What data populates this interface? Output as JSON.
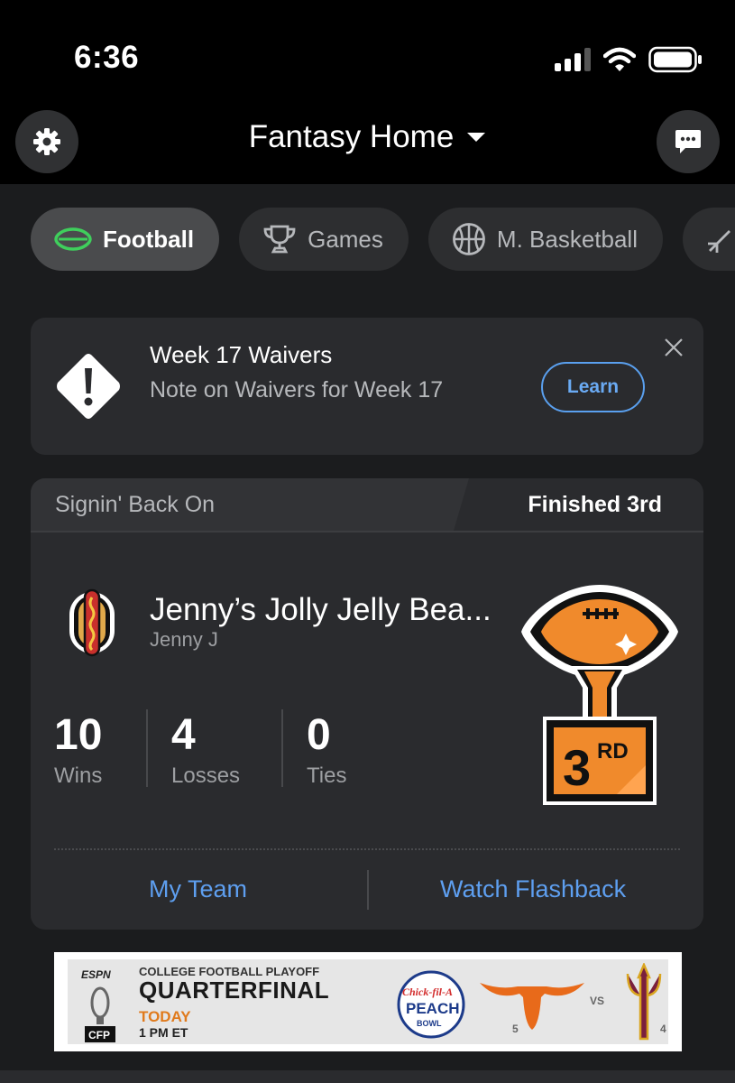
{
  "status": {
    "time": "6:36"
  },
  "header": {
    "title": "Fantasy Home"
  },
  "sports": [
    {
      "label": "Football",
      "icon": "football-icon",
      "active": true
    },
    {
      "label": "Games",
      "icon": "trophy-icon",
      "active": false
    },
    {
      "label": "M. Basketball",
      "icon": "basketball-icon",
      "active": false
    }
  ],
  "alert": {
    "title": "Week 17 Waivers",
    "subtitle": "Note on Waivers for Week 17",
    "button": "Learn"
  },
  "team_card": {
    "league": "Signin' Back On",
    "finish": "Finished 3rd",
    "team_name": "Jenny’s Jolly Jelly Bea...",
    "owner": "Jenny J",
    "stats": [
      {
        "value": "10",
        "label": "Wins"
      },
      {
        "value": "4",
        "label": "Losses"
      },
      {
        "value": "0",
        "label": "Ties"
      }
    ],
    "trophy_place": "3",
    "trophy_suffix": "RD",
    "actions": {
      "my_team": "My Team",
      "flashback": "Watch Flashback"
    }
  },
  "ad": {
    "network": "ESPN",
    "line1": "COLLEGE FOOTBALL PLAYOFF",
    "line2": "QUARTERFINAL",
    "line3": "TODAY",
    "line4": "1 PM ET",
    "badge": "CFP",
    "bowl1": "Chick-fil-A",
    "bowl2": "PEACH",
    "bowl3": "BOWL",
    "vs": "VS",
    "seed1": "5",
    "seed2": "4"
  },
  "colors": {
    "accent_blue": "#5e9ff0",
    "trophy_orange": "#f08a2c",
    "football_green": "#3fcf5c"
  }
}
